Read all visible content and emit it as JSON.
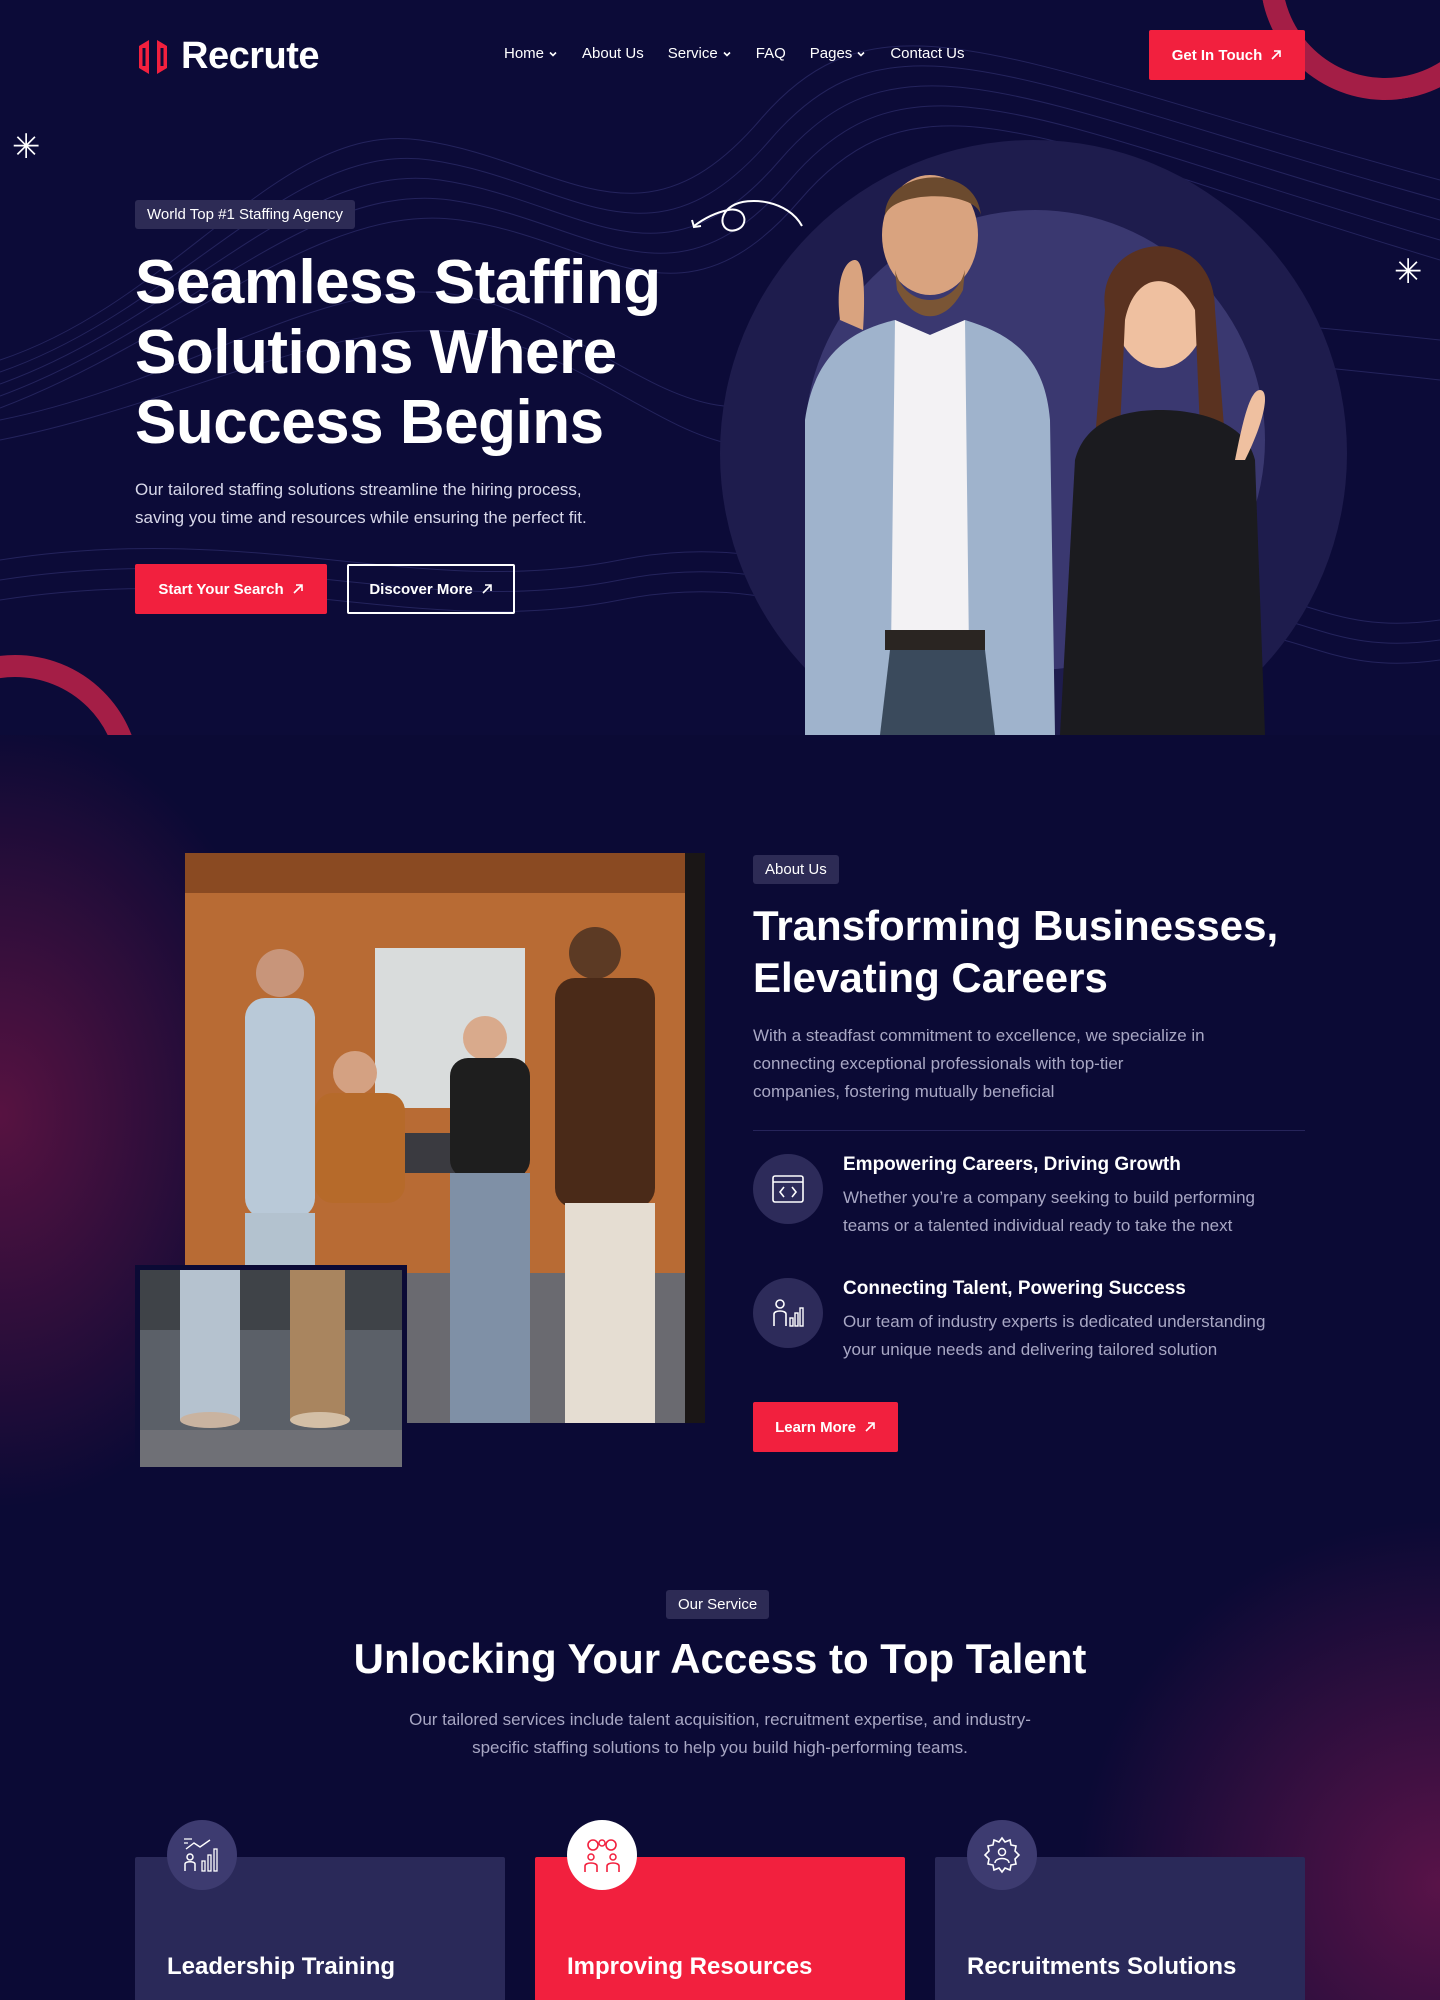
{
  "brand": {
    "name": "Recrute",
    "accent": "#f2203e",
    "background": "#0b0a35"
  },
  "nav": {
    "items": [
      {
        "label": "Home",
        "dropdown": true
      },
      {
        "label": "About Us",
        "dropdown": false
      },
      {
        "label": "Service",
        "dropdown": true
      },
      {
        "label": "FAQ",
        "dropdown": false
      },
      {
        "label": "Pages",
        "dropdown": true
      },
      {
        "label": "Contact Us",
        "dropdown": false
      }
    ],
    "cta": "Get In Touch"
  },
  "hero": {
    "badge": "World Top #1 Staffing Agency",
    "title_lines": [
      "Seamless Staffing",
      "Solutions Where",
      "Success Begins"
    ],
    "description_lines": [
      "Our tailored staffing solutions streamline the hiring process,",
      "saving you time and resources while ensuring the perfect fit."
    ],
    "primary_button": "Start Your Search",
    "secondary_button": "Discover More"
  },
  "about": {
    "badge": "About Us",
    "title_lines": [
      "Transforming Businesses,",
      "Elevating Careers"
    ],
    "description_lines": [
      "With a steadfast commitment to excellence, we specialize in",
      "connecting exceptional professionals with top-tier",
      "companies, fostering mutually beneficial"
    ],
    "features": [
      {
        "icon": "code-window-icon",
        "title": "Empowering Careers, Driving Growth",
        "description_lines": [
          "Whether you’re a company seeking to build performing",
          "teams or a talented individual ready to take the next"
        ]
      },
      {
        "icon": "person-growth-chart-icon",
        "title": "Connecting Talent, Powering Success",
        "description_lines": [
          "Our team of industry experts is dedicated understanding",
          "your unique needs and delivering tailored solution"
        ]
      }
    ],
    "button": "Learn More"
  },
  "services": {
    "badge": "Our Service",
    "title": "Unlocking Your Access to Top Talent",
    "description_lines": [
      "Our tailored services include talent acquisition, recruitment expertise, and industry-",
      "specific staffing solutions to help you build high-performing teams."
    ],
    "cards": [
      {
        "title": "Leadership Training",
        "icon": "leadership-chart-icon",
        "active": false
      },
      {
        "title": "Improving Resources",
        "icon": "team-ideas-icon",
        "active": true
      },
      {
        "title": "Recruitments Solutions",
        "icon": "gear-person-icon",
        "active": false
      }
    ]
  }
}
